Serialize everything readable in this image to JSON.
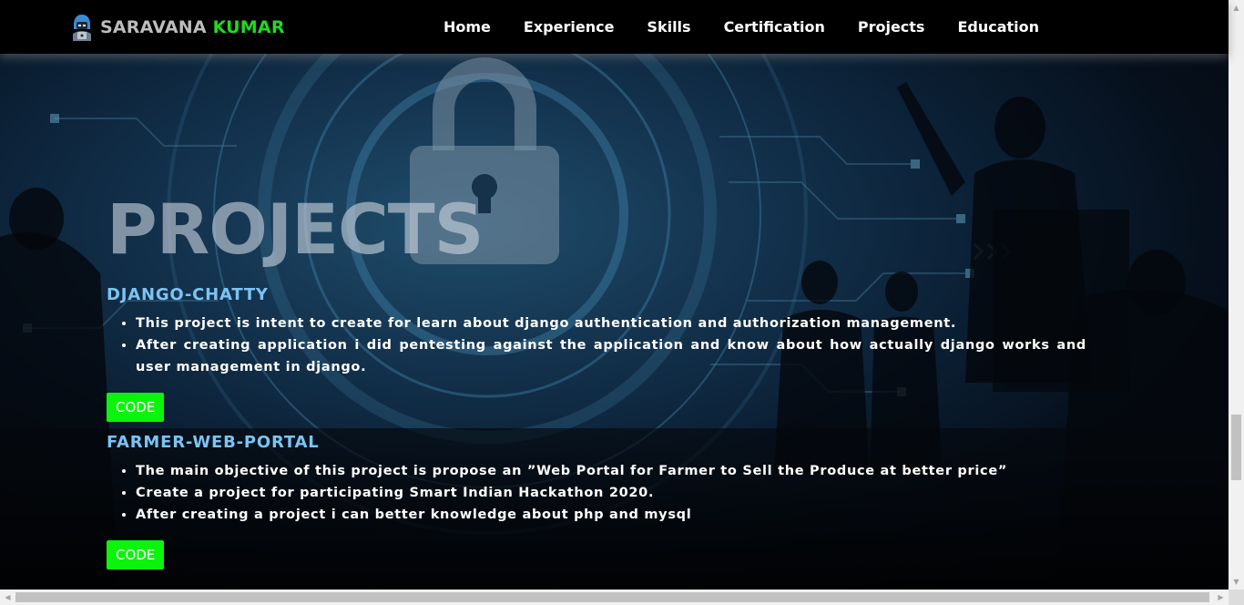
{
  "brand": {
    "first": "SARAVANA",
    "second": "KUMAR",
    "logo_icon": "hacker-avatar-icon",
    "accent_color": "#1fdc1f"
  },
  "nav": {
    "items": [
      "Home",
      "Experience",
      "Skills",
      "Certification",
      "Projects",
      "Education"
    ]
  },
  "page_title": "PROJECTS",
  "projects": [
    {
      "title": "DJANGO-CHATTY",
      "bullets": [
        "This project is intent to create for learn about django authentication and authorization management.",
        "After creating application i did pentesting against the application and know about how actually django works and user management in django."
      ],
      "button": "CODE"
    },
    {
      "title": "FARMER-WEB-PORTAL",
      "bullets": [
        "The main objective of this project is propose an ”Web Portal for Farmer to Sell the Produce at better price”",
        "Create a project for participating Smart Indian Hackathon 2020.",
        "After creating a project i can better knowledge about php and mysql"
      ],
      "button": "CODE"
    }
  ],
  "colors": {
    "title": "#7cc3f2",
    "button": "#0bf40b",
    "background": "#0b2035"
  }
}
